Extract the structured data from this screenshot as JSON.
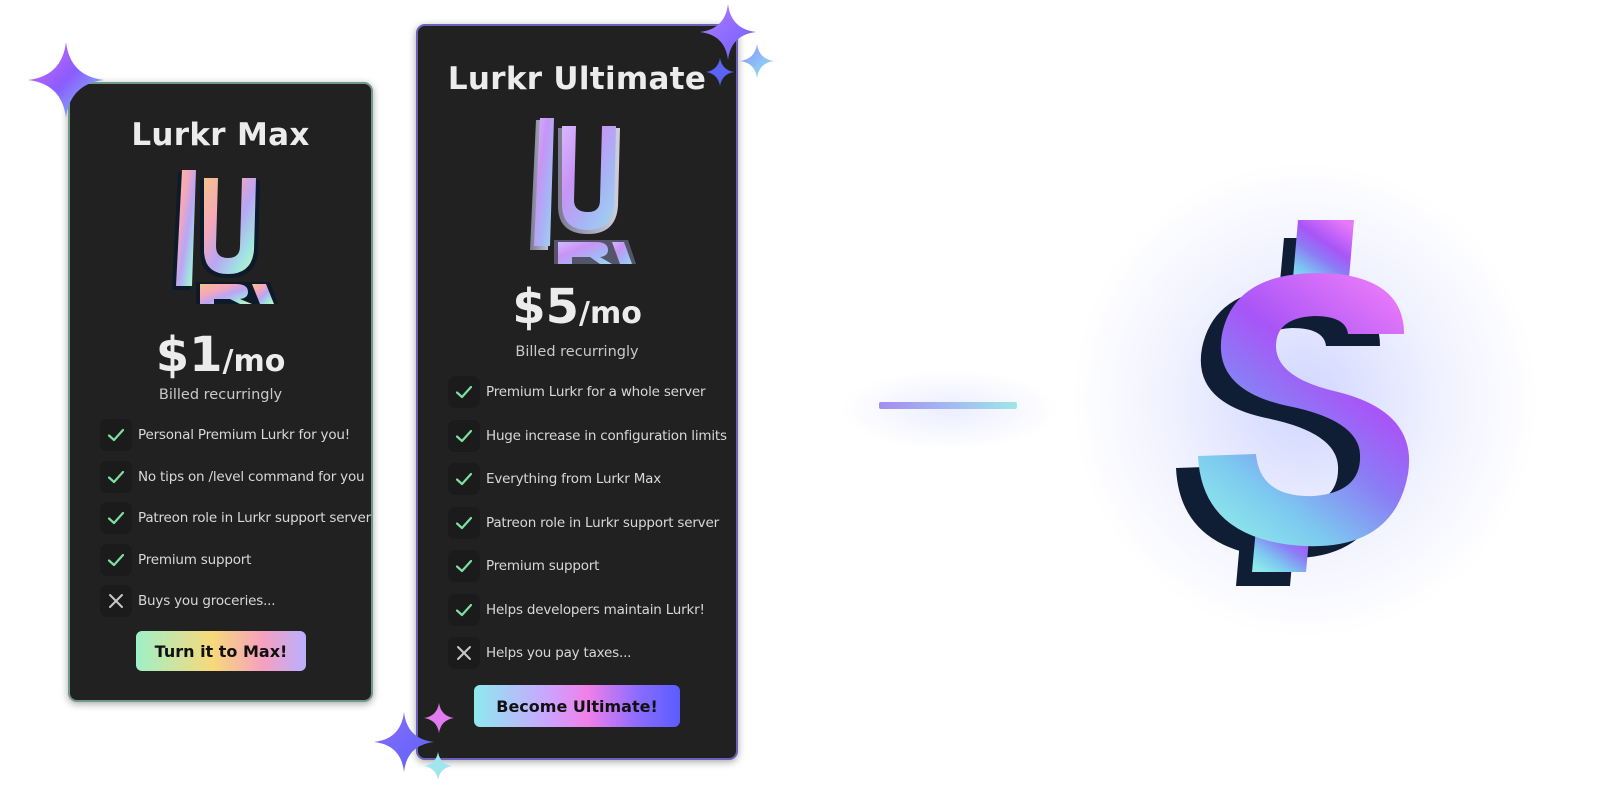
{
  "plans": [
    {
      "title": "Lurkr Max",
      "logo_text": "LURR",
      "price": "$1",
      "period": "/mo",
      "billing": "Billed recurringly",
      "features": [
        {
          "text": "Personal Premium Lurkr for you!",
          "included": true
        },
        {
          "text": "No tips on /level command for you",
          "included": true
        },
        {
          "text": "Patreon role in Lurkr support server",
          "included": true
        },
        {
          "text": "Premium support",
          "included": true
        },
        {
          "text": "Buys you groceries...",
          "included": false
        }
      ],
      "button": "Turn it to Max!"
    },
    {
      "title": "Lurkr Ultimate",
      "logo_text": "LURR",
      "price": "$5",
      "period": "/mo",
      "billing": "Billed recurringly",
      "features": [
        {
          "text": "Premium Lurkr for a whole server",
          "included": true
        },
        {
          "text": "Huge increase in configuration limits",
          "included": true
        },
        {
          "text": "Everything from Lurkr Max",
          "included": true
        },
        {
          "text": "Patreon role in Lurkr support server",
          "included": true
        },
        {
          "text": "Premium support",
          "included": true
        },
        {
          "text": "Helps developers maintain Lurkr!",
          "included": true
        },
        {
          "text": "Helps you pay taxes...",
          "included": false
        }
      ],
      "button": "Become Ultimate!"
    }
  ],
  "colors": {
    "card_bg": "#212121",
    "check": "#7ee0a0",
    "cross": "#c8c8c8",
    "max_border": "#6f9a8a",
    "ultimate_border": "#6b61b8",
    "sparkle_purple": "#9b59ff",
    "sparkle_cyan": "#8fe9ef"
  },
  "icons": [
    "sparkle-icon",
    "lurkr-logo",
    "check-icon",
    "cross-icon",
    "dollar-icon"
  ]
}
